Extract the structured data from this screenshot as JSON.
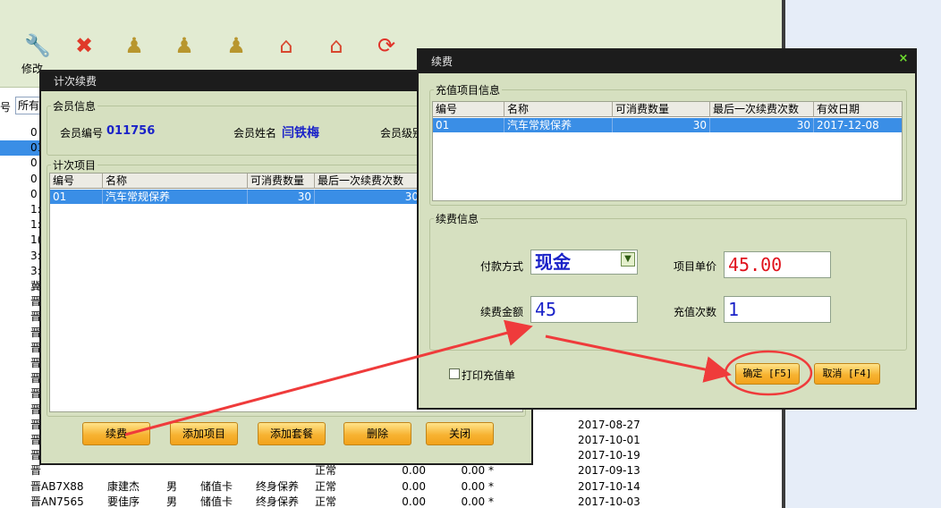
{
  "toolbar": {
    "first_label": "修改"
  },
  "background": {
    "filter_label": "号",
    "filter_value": "所有",
    "grid_rows": [
      {
        "plate": "0",
        "name": "",
        "gender": "",
        "card": "",
        "type": "",
        "status": "",
        "a1": "",
        "a2": "",
        "date": ""
      },
      {
        "plate": "01",
        "name": "",
        "gender": "",
        "card": "",
        "type": "",
        "status": "",
        "a1": "",
        "a2": "",
        "date": ""
      },
      {
        "plate": "0",
        "name": "",
        "gender": "",
        "card": "",
        "type": "",
        "status": "",
        "a1": "",
        "a2": "",
        "date": ""
      },
      {
        "plate": "0",
        "name": "",
        "gender": "",
        "card": "",
        "type": "",
        "status": "",
        "a1": "",
        "a2": "",
        "date": ""
      },
      {
        "plate": "0",
        "name": "",
        "gender": "",
        "card": "",
        "type": "",
        "status": "",
        "a1": "",
        "a2": "",
        "date": ""
      },
      {
        "plate": "1:",
        "name": "",
        "gender": "",
        "card": "",
        "type": "",
        "status": "",
        "a1": "",
        "a2": "",
        "date": ""
      },
      {
        "plate": "1:",
        "name": "",
        "gender": "",
        "card": "",
        "type": "",
        "status": "",
        "a1": "",
        "a2": "",
        "date": ""
      },
      {
        "plate": "1(",
        "name": "",
        "gender": "",
        "card": "",
        "type": "",
        "status": "",
        "a1": "",
        "a2": "",
        "date": ""
      },
      {
        "plate": "3:",
        "name": "",
        "gender": "",
        "card": "",
        "type": "",
        "status": "",
        "a1": "",
        "a2": "",
        "date": ""
      },
      {
        "plate": "3:",
        "name": "",
        "gender": "",
        "card": "",
        "type": "",
        "status": "",
        "a1": "",
        "a2": "",
        "date": ""
      },
      {
        "plate": "冀",
        "name": "",
        "gender": "",
        "card": "",
        "type": "",
        "status": "",
        "a1": "",
        "a2": "",
        "date": ""
      },
      {
        "plate": "晋",
        "name": "",
        "gender": "",
        "card": "",
        "type": "",
        "status": "",
        "a1": "",
        "a2": "",
        "date": ""
      },
      {
        "plate": "晋",
        "name": "",
        "gender": "",
        "card": "",
        "type": "",
        "status": "",
        "a1": "",
        "a2": "",
        "date": ""
      },
      {
        "plate": "晋",
        "name": "",
        "gender": "",
        "card": "",
        "type": "",
        "status": "",
        "a1": "",
        "a2": "",
        "date": ""
      },
      {
        "plate": "晋",
        "name": "",
        "gender": "",
        "card": "",
        "type": "",
        "status": "",
        "a1": "",
        "a2": "",
        "date": ""
      },
      {
        "plate": "晋",
        "name": "",
        "gender": "",
        "card": "",
        "type": "",
        "status": "",
        "a1": "",
        "a2": "",
        "date": ""
      },
      {
        "plate": "晋",
        "name": "",
        "gender": "",
        "card": "",
        "type": "",
        "status": "",
        "a1": "",
        "a2": "",
        "date": ""
      },
      {
        "plate": "晋",
        "name": "",
        "gender": "",
        "card": "",
        "type": "",
        "status": "",
        "a1": "",
        "a2": "",
        "date": ""
      },
      {
        "plate": "晋",
        "name": "",
        "gender": "",
        "card": "",
        "type": "",
        "status": "",
        "a1": "",
        "a2": "",
        "date": ""
      },
      {
        "plate": "晋",
        "name": "",
        "gender": "",
        "card": "",
        "type": "",
        "status": "",
        "a1": "",
        "a2": "",
        "date": "2017-08-27"
      },
      {
        "plate": "晋",
        "name": "",
        "gender": "",
        "card": "",
        "type": "",
        "status": "",
        "a1": "",
        "a2": "",
        "date": "2017-10-01"
      },
      {
        "plate": "晋",
        "name": "",
        "gender": "",
        "card": "",
        "type": "",
        "status": "",
        "a1": "",
        "a2": "",
        "date": "2017-10-19"
      },
      {
        "plate": "晋",
        "name": "",
        "gender": "",
        "card": "",
        "type": "",
        "status": "正常",
        "a1": "0.00",
        "a2": "0.00 *",
        "date": "2017-09-13"
      },
      {
        "plate": "晋AB7X88",
        "name": "康建杰",
        "gender": "男",
        "card": "储值卡",
        "type": "终身保养",
        "status": "正常",
        "a1": "0.00",
        "a2": "0.00 *",
        "date": "2017-10-14"
      },
      {
        "plate": "晋AN7565",
        "name": "要佳序",
        "gender": "男",
        "card": "储值卡",
        "type": "终身保养",
        "status": "正常",
        "a1": "0.00",
        "a2": "0.00 *",
        "date": "2017-10-03"
      }
    ]
  },
  "dialog1": {
    "title": "计次续费",
    "member_group_title": "会员信息",
    "member_no_label": "会员编号",
    "member_no_value": "011756",
    "member_name_label": "会员姓名",
    "member_name_value": "闫铁梅",
    "member_level_label": "会员级别",
    "items_group_title": "计次项目",
    "columns": [
      "编号",
      "名称",
      "可消费数量",
      "最后一次续费次数"
    ],
    "rows": [
      {
        "code": "01",
        "name": "汽车常规保养",
        "qty": "30",
        "last": "30"
      }
    ],
    "buttons": {
      "renew": "续费",
      "add_item": "添加项目",
      "add_package": "添加套餐",
      "delete": "删除",
      "close": "关闭"
    }
  },
  "dialog2": {
    "title": "续费",
    "close_glyph": "×",
    "recharge_group_title": "充值项目信息",
    "columns": [
      "编号",
      "名称",
      "可消费数量",
      "最后一次续费次数",
      "有效日期"
    ],
    "rows": [
      {
        "code": "01",
        "name": "汽车常规保养",
        "qty": "30",
        "last": "30",
        "expire": "2017-12-08"
      }
    ],
    "renew_group_title": "续费信息",
    "payment_label": "付款方式",
    "payment_value": "现金",
    "unit_price_label": "项目单价",
    "unit_price_value": "45.00",
    "amount_label": "续费金额",
    "amount_value": "45",
    "times_label": "充值次数",
    "times_value": "1",
    "print_label": "打印充值单",
    "print_checked": false,
    "confirm_label": "确定 [F5]",
    "cancel_label": "取消 [F4]"
  },
  "colors": {
    "dialog_bg": "#d6e0c0",
    "titlebar": "#1c1c1c",
    "selection": "#3a8ee6",
    "annotation": "#ef3b3b",
    "value_blue": "#1a22c8",
    "value_red": "#e0121c"
  }
}
